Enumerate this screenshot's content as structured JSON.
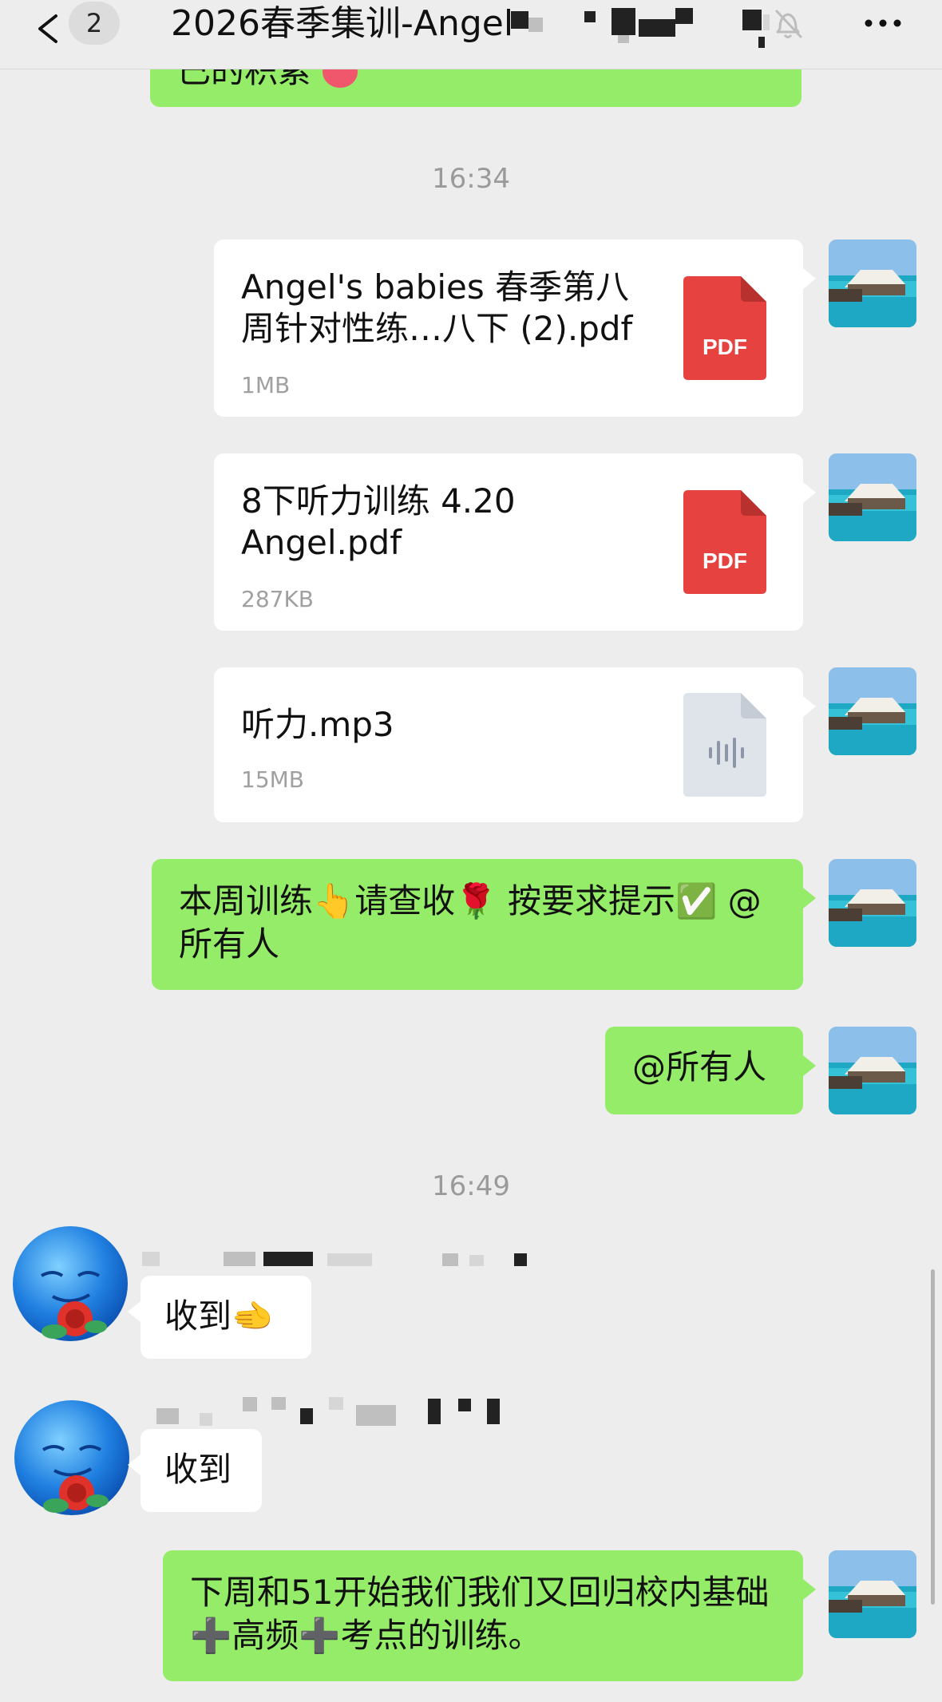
{
  "header": {
    "unread_count": "2",
    "title": "2026春季集训-Angel"
  },
  "messages": {
    "top_partial_text": "已的积累",
    "time_1": "16:34",
    "file_1": {
      "name": "Angel's babies 春季第八周针对性练…八下 (2).pdf",
      "size": "1MB",
      "type_label": "PDF"
    },
    "file_2": {
      "name": "8下听力训练 4.20 Angel.pdf",
      "size": "287KB",
      "type_label": "PDF"
    },
    "file_3": {
      "name": "听力.mp3",
      "size": "15MB"
    },
    "text_1": "本周训练👆请查收🌹 按要求提示✅ @所有人",
    "text_2": "@所有人",
    "time_2": "16:49",
    "reply_1": "收到🫲",
    "reply_2": "收到",
    "text_3": "下周和51开始我们我们又回归校内基础➕高频➕考点的训练。"
  },
  "colors": {
    "background": "#ededed",
    "outgoing_bubble": "#95ec69",
    "incoming_bubble": "#ffffff",
    "pdf_icon": "#e64340",
    "audio_icon": "#dfe3ea"
  },
  "icons": {
    "back": "chevron-left-icon",
    "mute": "bell-slash-icon",
    "more": "more-icon",
    "pdf": "pdf-file-icon",
    "audio": "audio-file-icon"
  }
}
